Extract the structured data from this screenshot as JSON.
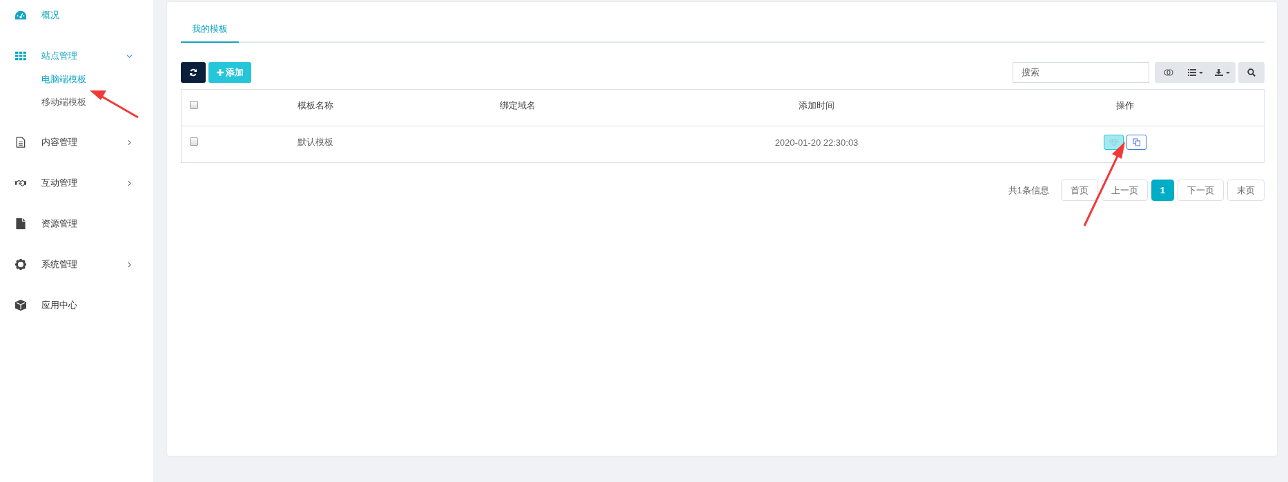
{
  "sidebar": {
    "items": [
      {
        "label": "概况",
        "active": true
      },
      {
        "label": "站点管理",
        "active": true,
        "expanded": true,
        "children": [
          {
            "label": "电脑端模板",
            "selected": true
          },
          {
            "label": "移动端模板",
            "selected": false
          }
        ]
      },
      {
        "label": "内容管理",
        "active": false,
        "expanded": false
      },
      {
        "label": "互动管理",
        "active": false,
        "expanded": false
      },
      {
        "label": "资源管理",
        "active": false
      },
      {
        "label": "系统管理",
        "active": false,
        "expanded": false
      },
      {
        "label": "应用中心",
        "active": false
      }
    ]
  },
  "tabs": [
    {
      "label": "我的模板",
      "selected": true
    }
  ],
  "toolbar": {
    "add_label": "添加",
    "search": {
      "placeholder": "搜索"
    }
  },
  "table": {
    "select_all_checked": false,
    "columns": [
      "模板名称",
      "绑定域名",
      "添加时间",
      "操作"
    ],
    "rows": [
      {
        "checked": false,
        "name": "默认模板",
        "added": "2020-01-20 22:30:03",
        "actions": [
          {
            "highlighted": true
          },
          {
            "highlighted": false
          }
        ]
      }
    ]
  },
  "pagination": {
    "summary": "共1条信息",
    "pages": [
      {
        "label": "首页",
        "selected": false
      },
      {
        "label": "上一页",
        "selected": false
      },
      {
        "label": "1",
        "selected": true
      },
      {
        "label": "下一页",
        "selected": false
      },
      {
        "label": "末页",
        "selected": false
      }
    ]
  }
}
